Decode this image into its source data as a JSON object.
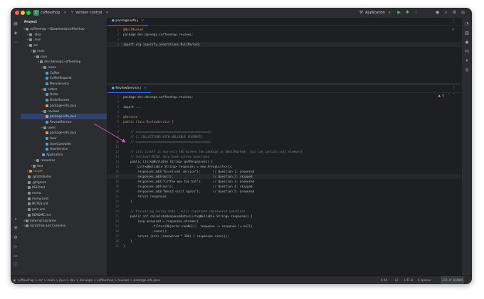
{
  "titlebar": {
    "project_badge": "C",
    "project_name": "coffeeshop",
    "vcs": "Version control",
    "run_config": "Application"
  },
  "project_panel": {
    "title": "Project",
    "tree": [
      {
        "label": "coffeeshop ~/Downloads/coffeeshop",
        "indent": 0,
        "kind": "folder"
      },
      {
        "label": ".idea",
        "indent": 1,
        "kind": "folder"
      },
      {
        "label": ".mvn",
        "indent": 1,
        "kind": "folder"
      },
      {
        "label": "src",
        "indent": 1,
        "kind": "folder"
      },
      {
        "label": "main",
        "indent": 2,
        "kind": "folder"
      },
      {
        "label": "java",
        "indent": 3,
        "kind": "folder"
      },
      {
        "label": "dev.danvega.coffeeshop",
        "indent": 4,
        "kind": "package"
      },
      {
        "label": "menu",
        "indent": 5,
        "kind": "package"
      },
      {
        "label": "Coffee",
        "indent": 6,
        "kind": "class"
      },
      {
        "label": "CoffeeRequest",
        "indent": 6,
        "kind": "class"
      },
      {
        "label": "MenuService",
        "indent": 6,
        "kind": "class"
      },
      {
        "label": "orders",
        "indent": 5,
        "kind": "package"
      },
      {
        "label": "Order",
        "indent": 6,
        "kind": "class"
      },
      {
        "label": "OrderService",
        "indent": 6,
        "kind": "class"
      },
      {
        "label": "package-info.java",
        "indent": 6,
        "kind": "java"
      },
      {
        "label": "reviews",
        "indent": 5,
        "kind": "package"
      },
      {
        "label": "package-info.java",
        "indent": 6,
        "kind": "java",
        "selected": true
      },
      {
        "label": "ReviewService",
        "indent": 6,
        "kind": "class"
      },
      {
        "label": "users",
        "indent": 5,
        "kind": "package"
      },
      {
        "label": "package-info.java",
        "indent": 6,
        "kind": "java"
      },
      {
        "label": "User",
        "indent": 6,
        "kind": "class"
      },
      {
        "label": "UserController",
        "indent": 6,
        "kind": "class"
      },
      {
        "label": "UserService",
        "indent": 6,
        "kind": "class"
      },
      {
        "label": "Application",
        "indent": 5,
        "kind": "class"
      },
      {
        "label": "resources",
        "indent": 3,
        "kind": "folder"
      },
      {
        "label": "test",
        "indent": 2,
        "kind": "folder"
      },
      {
        "label": "target",
        "indent": 1,
        "kind": "folder-orange"
      },
      {
        "label": ".gitattributes",
        "indent": 1,
        "kind": "file"
      },
      {
        "label": ".gitignore",
        "indent": 1,
        "kind": "file"
      },
      {
        "label": "HELP.md",
        "indent": 1,
        "kind": "file"
      },
      {
        "label": "mvnw",
        "indent": 1,
        "kind": "file"
      },
      {
        "label": "mvnw.cmd",
        "indent": 1,
        "kind": "file"
      },
      {
        "label": "NOTES.md",
        "indent": 1,
        "kind": "file"
      },
      {
        "label": "pom.xml",
        "indent": 1,
        "kind": "file"
      },
      {
        "label": "README.md",
        "indent": 1,
        "kind": "file"
      },
      {
        "label": "External Libraries",
        "indent": 0,
        "kind": "folder"
      },
      {
        "label": "Scratches and Consoles",
        "indent": 0,
        "kind": "folder"
      }
    ]
  },
  "editor_top": {
    "tab": "package-info.j",
    "lines": [
      {
        "n": "1",
        "text": "@NullMarked",
        "color": "#b3ae60"
      },
      {
        "n": "2",
        "text": "package dev.danvega.coffeeshop.reviews;",
        "color": "#bcbec4"
      },
      {
        "n": "3",
        "text": "",
        "color": "#bcbec4"
      },
      {
        "n": "4",
        "text": "import org.jspecify.annotations.NullMarked;",
        "color": "#bcbec4",
        "current": true
      }
    ]
  },
  "editor_bottom": {
    "tab": "ReviewService.j",
    "inspection": "4",
    "lines": [
      {
        "n": "1",
        "text": "package dev.danvega.coffeeshop.reviews;",
        "color": "#bcbec4"
      },
      {
        "n": "2",
        "text": "",
        "color": "#bcbec4"
      },
      {
        "n": "3",
        "text": "import ...",
        "color": "#bcbec4"
      },
      {
        "n": "4",
        "text": "",
        "color": "#bcbec4"
      },
      {
        "n": "5",
        "text": "@Service",
        "color": "#b3ae60"
      },
      {
        "n": "6",
        "text": "public class ReviewService {",
        "color": "#cf8e6d"
      },
      {
        "n": "7",
        "text": "",
        "color": "#bcbec4"
      },
      {
        "n": "8",
        "text": "    // ==========================================",
        "color": "#7a7e85"
      },
      {
        "n": "9",
        "text": "    // 1. COLLECTIONS WITH NULLABLE ELEMENTS",
        "color": "#7a7e85"
      },
      {
        "n": "10",
        "text": "    // ==========================================",
        "color": "#7a7e85"
      },
      {
        "n": "11",
        "text": "",
        "color": "#bcbec4"
      },
      {
        "n": "12",
        "text": "    // List itself is non-null (NO marked the package as @NullMarked), but can contain null elements",
        "color": "#7a7e85"
      },
      {
        "n": "13",
        "text": "    // (without NCSE) skip book survey questions",
        "color": "#7a7e85"
      },
      {
        "n": "14",
        "text": "    public List<@Nullable String> getResponses() {",
        "color": "#bcbec4"
      },
      {
        "n": "15",
        "text": "        List<@Nullable String> responses = new ArrayList<>();",
        "color": "#bcbec4"
      },
      {
        "n": "16",
        "text": "        responses.add(\"Excellent service\");       // Question 1: answered",
        "color": "#bcbec4"
      },
      {
        "n": "17",
        "text": "        responses.add(null);                      // Question 2: skipped",
        "color": "#bcbec4",
        "current": true
      },
      {
        "n": "18",
        "text": "        responses.add(\"Coffee was too hot\");      // Question 3: answered",
        "color": "#bcbec4"
      },
      {
        "n": "19",
        "text": "        responses.add(null);                      // Question 4: skipped",
        "color": "#bcbec4"
      },
      {
        "n": "20",
        "text": "        responses.add(\"Would visit again\");       // Question 5: answered",
        "color": "#bcbec4"
      },
      {
        "n": "21",
        "text": "        return responses;",
        "color": "#bcbec4"
      },
      {
        "n": "22",
        "text": "    }",
        "color": "#bcbec4"
      },
      {
        "n": "23",
        "text": "",
        "color": "#bcbec4"
      },
      {
        "n": "24",
        "text": "    // Processing survey data - nulls represent unanswered questions",
        "color": "#7a7e85"
      },
      {
        "n": "25",
        "text": "    public int calculateResponseRate(List<@Nullable String> responses) {",
        "color": "#bcbec4"
      },
      {
        "n": "26",
        "text": "        long answered = responses.stream()",
        "color": "#bcbec4"
      },
      {
        "n": "27",
        "text": "                .filter(Objects::nonNull)  response -> response != null)",
        "color": "#bcbec4"
      },
      {
        "n": "28",
        "text": "                .count();",
        "color": "#bcbec4"
      },
      {
        "n": "29",
        "text": "        return (int) ((answered * 100) / responses.size());",
        "color": "#bcbec4"
      },
      {
        "n": "30",
        "text": "    }",
        "color": "#bcbec4"
      },
      {
        "n": "31",
        "text": "}",
        "color": "#bcbec4"
      }
    ]
  },
  "statusbar": {
    "breadcrumb": "coffeeshop > src > main > java > dev > danvega > coffeeshop > reviews > package-info.java",
    "position": "4:44",
    "line_sep": "LF",
    "encoding": "UTF-8",
    "indent": "4 spaces",
    "memory": "311 of 2048M"
  },
  "colors": {
    "accent": "#3574f0",
    "arrow": "#d64fd6",
    "selection": "#2e436e"
  }
}
